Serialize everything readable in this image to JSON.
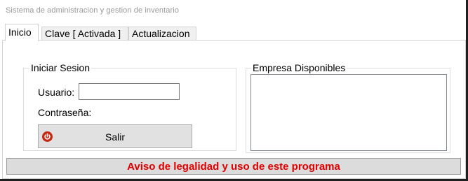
{
  "window": {
    "title": "Sistema de administracion y gestion de inventario"
  },
  "tabs": [
    {
      "label": "Inicio",
      "active": true
    },
    {
      "label": "Clave [ Activada ]",
      "active": false
    },
    {
      "label": "Actualizacion",
      "active": false
    }
  ],
  "login": {
    "group_title": "Iniciar Sesion",
    "user_label": "Usuario:",
    "user_value": "",
    "password_label": "Contraseña:",
    "exit_button_label": "Salir",
    "exit_icon": "power-icon",
    "exit_icon_color": "#c8280f"
  },
  "companies": {
    "group_title": "Empresa Disponibles",
    "items": []
  },
  "notice": {
    "label": "Aviso de legalidad y uso de este programa",
    "color": "#e00000"
  }
}
